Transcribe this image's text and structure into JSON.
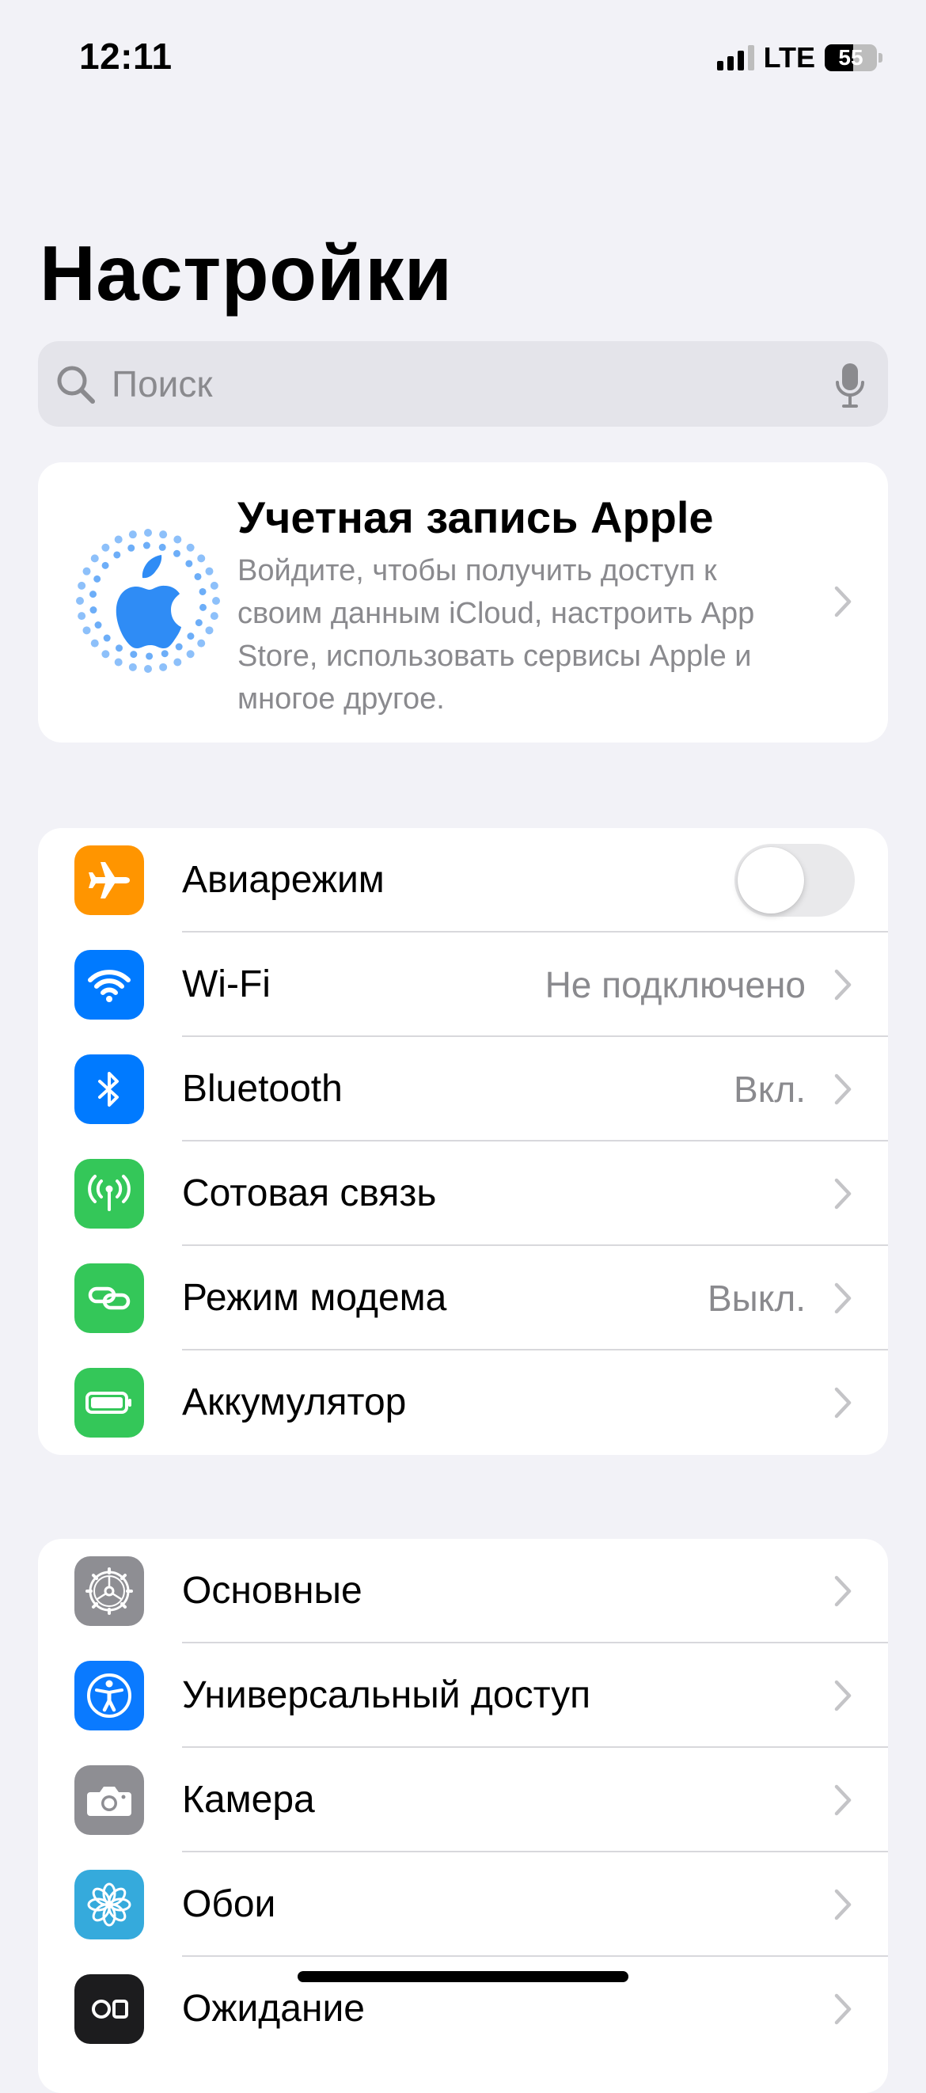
{
  "status_bar": {
    "time": "12:11",
    "network": "LTE",
    "battery_percent": "55",
    "battery_level": 0.55,
    "signal_bars_active": 3,
    "signal_bars_total": 4
  },
  "title": "Настройки",
  "search": {
    "placeholder": "Поиск",
    "value": ""
  },
  "account": {
    "title": "Учетная запись Apple",
    "description": "Войдите, чтобы получить доступ к своим данным iCloud, настроить App Store, использовать сервисы Apple и многое другое.",
    "avatar_icon": "apple-logo-icon",
    "accent_color": "#2F8CF5"
  },
  "network_group": [
    {
      "id": "airplane",
      "label": "Авиарежим",
      "value": "",
      "icon": "airplane-icon",
      "color": "#FF9500",
      "toggle": false
    },
    {
      "id": "wifi",
      "label": "Wi-Fi",
      "value": "Не подключено",
      "icon": "wifi-icon",
      "color": "#007AFF"
    },
    {
      "id": "bluetooth",
      "label": "Bluetooth",
      "value": "Вкл.",
      "icon": "bluetooth-icon",
      "color": "#007AFF"
    },
    {
      "id": "cellular",
      "label": "Сотовая связь",
      "value": "",
      "icon": "cellular-antenna-icon",
      "color": "#34C759"
    },
    {
      "id": "hotspot",
      "label": "Режим модема",
      "value": "Выкл.",
      "icon": "hotspot-chain-icon",
      "color": "#34C759"
    },
    {
      "id": "battery",
      "label": "Аккумулятор",
      "value": "",
      "icon": "battery-icon",
      "color": "#34C759"
    }
  ],
  "general_group": [
    {
      "id": "general",
      "label": "Основные",
      "icon": "gear-icon",
      "color": "#8E8E93"
    },
    {
      "id": "accessibility",
      "label": "Универсальный доступ",
      "icon": "accessibility-icon",
      "color": "#0A7AFF"
    },
    {
      "id": "camera",
      "label": "Камера",
      "icon": "camera-icon",
      "color": "#8E8E93"
    },
    {
      "id": "wallpaper",
      "label": "Обои",
      "icon": "wallpaper-flower-icon",
      "color": "#35AADC"
    },
    {
      "id": "standby",
      "label": "Ожидание",
      "icon": "standby-icon",
      "color": "#1C1C1E"
    }
  ]
}
